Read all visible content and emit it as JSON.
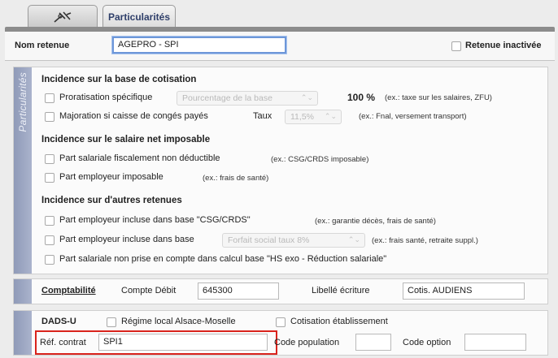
{
  "tabs": [
    {
      "icon": "tools-icon",
      "label": ""
    },
    {
      "label": "Particularités"
    }
  ],
  "header": {
    "nom_label": "Nom retenue",
    "nom_value": "AGEPRO - SPI",
    "inactivee_label": "Retenue inactivée"
  },
  "sidebar_label": "Particularités",
  "cotisation": {
    "title": "Incidence sur la base de cotisation",
    "prorat_label": "Proratisation spécifique",
    "prorat_select": "Pourcentage de la base",
    "prorat_value": "100 %",
    "prorat_note": "(ex.: taxe sur les salaires, ZFU)",
    "majoration_label": "Majoration si caisse de congés payés",
    "taux_label": "Taux",
    "taux_select": "11,5%",
    "taux_note": "(ex.: Fnal, versement transport)"
  },
  "net": {
    "title": "Incidence sur le salaire net imposable",
    "item1": "Part salariale fiscalement non déductible",
    "item1_note": "(ex.: CSG/CRDS imposable)",
    "item2": "Part employeur imposable",
    "item2_note": "(ex.: frais de santé)"
  },
  "autres": {
    "title": "Incidence sur d'autres retenues",
    "item1": "Part employeur incluse dans base \"CSG/CRDS\"",
    "item1_note": "(ex.: garantie décès, frais de santé)",
    "item2": "Part employeur incluse dans base",
    "item2_select": "Forfait social taux 8%",
    "item2_note": "(ex.: frais santé, retraite suppl.)",
    "item3": "Part salariale non prise en compte dans calcul base \"HS exo - Réduction salariale\""
  },
  "compta": {
    "title": "Comptabilité",
    "debit_label": "Compte Débit",
    "debit_value": "645300",
    "libelle_label": "Libellé écriture",
    "libelle_value": "Cotis. AUDIENS"
  },
  "dads": {
    "title": "DADS-U",
    "regime_label": "Régime local Alsace-Moselle",
    "cotisation_label": "Cotisation établissement",
    "ref_label": "Réf. contrat",
    "ref_value": "SPI1",
    "codepop_label": "Code population",
    "codepop_value": "",
    "codeopt_label": "Code option",
    "codeopt_value": ""
  }
}
